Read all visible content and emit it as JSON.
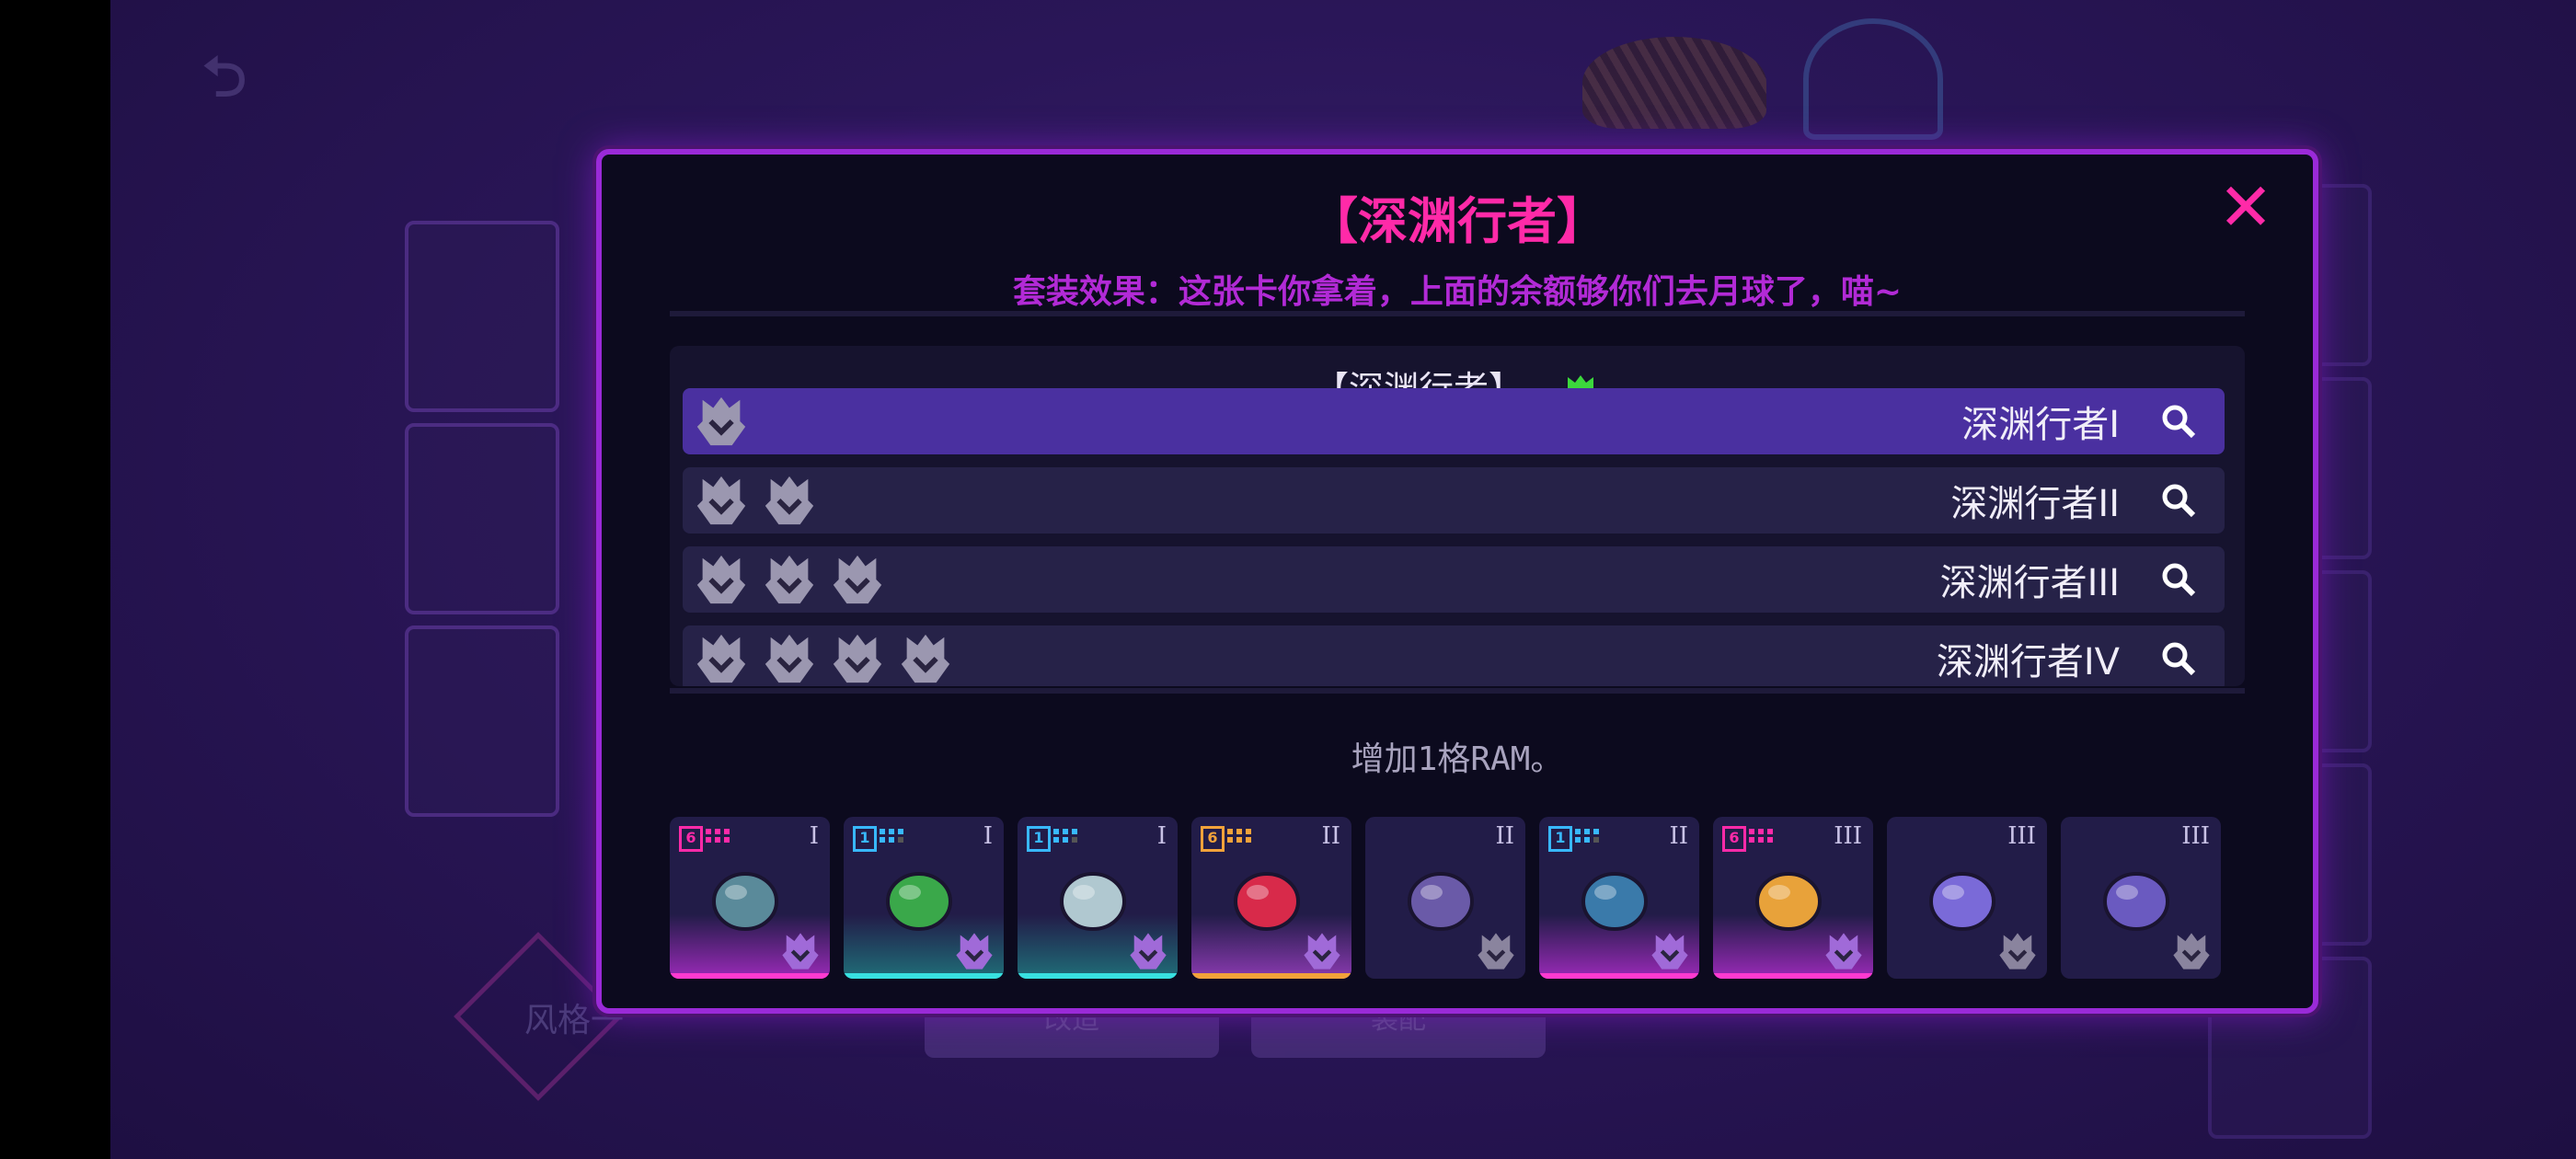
{
  "modal": {
    "title": "【深渊行者】",
    "close_symbol": "✕",
    "set_effect_text": "套装效果：这张卡你拿着，上面的余额够你们去月球了，喵~"
  },
  "set_panel": {
    "header": "【深渊行者】",
    "tiers": [
      {
        "name": "深渊行者I",
        "icon_count": 1,
        "selected": true
      },
      {
        "name": "深渊行者II",
        "icon_count": 2,
        "selected": false
      },
      {
        "name": "深渊行者III",
        "icon_count": 3,
        "selected": false
      },
      {
        "name": "深渊行者IV",
        "icon_count": 4,
        "selected": false
      }
    ]
  },
  "tier_effect": "增加1格RAM。",
  "cards": [
    {
      "tier": "I",
      "cost": "6",
      "rarity": "pink",
      "art": "gun-icon"
    },
    {
      "tier": "I",
      "cost": "1",
      "rarity": "teal",
      "art": "cat-icon"
    },
    {
      "tier": "I",
      "cost": "1",
      "rarity": "teal",
      "art": "map-icon"
    },
    {
      "tier": "II",
      "cost": "6",
      "rarity": "orange",
      "art": "snake-icon"
    },
    {
      "tier": "II",
      "cost": "",
      "rarity": "none",
      "art": "clam-icon"
    },
    {
      "tier": "II",
      "cost": "1",
      "rarity": "pink",
      "art": "monitor-icon"
    },
    {
      "tier": "III",
      "cost": "6",
      "rarity": "pink",
      "art": "pie-icon"
    },
    {
      "tier": "III",
      "cost": "",
      "rarity": "none",
      "art": "tooth-icon"
    },
    {
      "tier": "III",
      "cost": "",
      "rarity": "none",
      "art": "vase-icon"
    }
  ],
  "background": {
    "style_label": "风格一",
    "button_left": "改造",
    "button_right": "装配"
  },
  "colors": {
    "accent_pink": "#ff2aa8",
    "accent_purple": "#9a2ad8",
    "selected_row": "#4a30a0",
    "set_green": "#3cd83c"
  }
}
